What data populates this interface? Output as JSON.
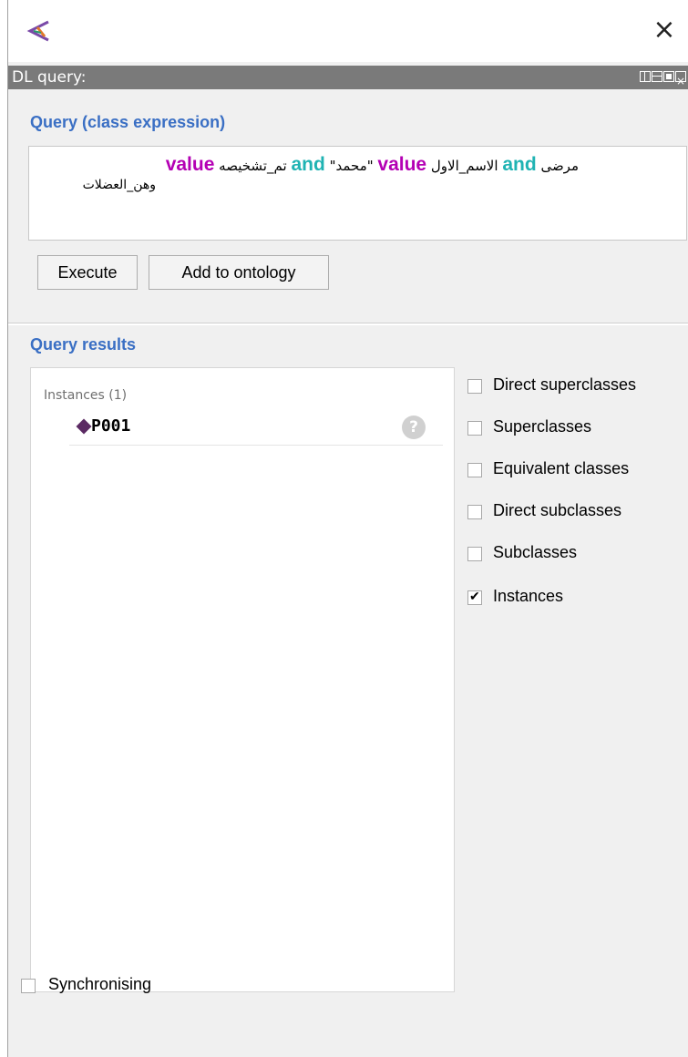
{
  "window": {
    "close_icon": "close-icon",
    "logo_icon": "protege-logo-icon"
  },
  "panel": {
    "title": "DL query:"
  },
  "query_section": {
    "title": "Query (class expression)",
    "expression": {
      "line1": [
        {
          "text": "مرضى",
          "type": "word"
        },
        {
          "text": "and",
          "type": "keyword-and"
        },
        {
          "text": "الاسم_الاول",
          "type": "word"
        },
        {
          "text": "value",
          "type": "keyword-value"
        },
        {
          "text": "\"محمد\"",
          "type": "word"
        },
        {
          "text": "and",
          "type": "keyword-and"
        },
        {
          "text": "تم_تشخيصه",
          "type": "word"
        },
        {
          "text": "value",
          "type": "keyword-value"
        }
      ],
      "line2": "وهن_العضلات"
    },
    "execute_label": "Execute",
    "add_label": "Add to ontology"
  },
  "results_section": {
    "title": "Query results",
    "instances_label": "Instances (1)",
    "instances": [
      {
        "name": "P001",
        "help": "?"
      }
    ]
  },
  "options": [
    {
      "label": "Direct superclasses",
      "checked": false
    },
    {
      "label": "Superclasses",
      "checked": false
    },
    {
      "label": "Equivalent classes",
      "checked": false
    },
    {
      "label": "Direct subclasses",
      "checked": false
    },
    {
      "label": "Subclasses",
      "checked": false
    },
    {
      "label": "Instances",
      "checked": true
    }
  ],
  "sync": {
    "label": "Synchronising",
    "checked": false
  },
  "colors": {
    "accent_title": "#3a6fc4",
    "keyword_and": "#1fb3b3",
    "keyword_value": "#b400b4",
    "panel_header": "#7a7a7a",
    "instance_icon": "#5b2a63"
  }
}
